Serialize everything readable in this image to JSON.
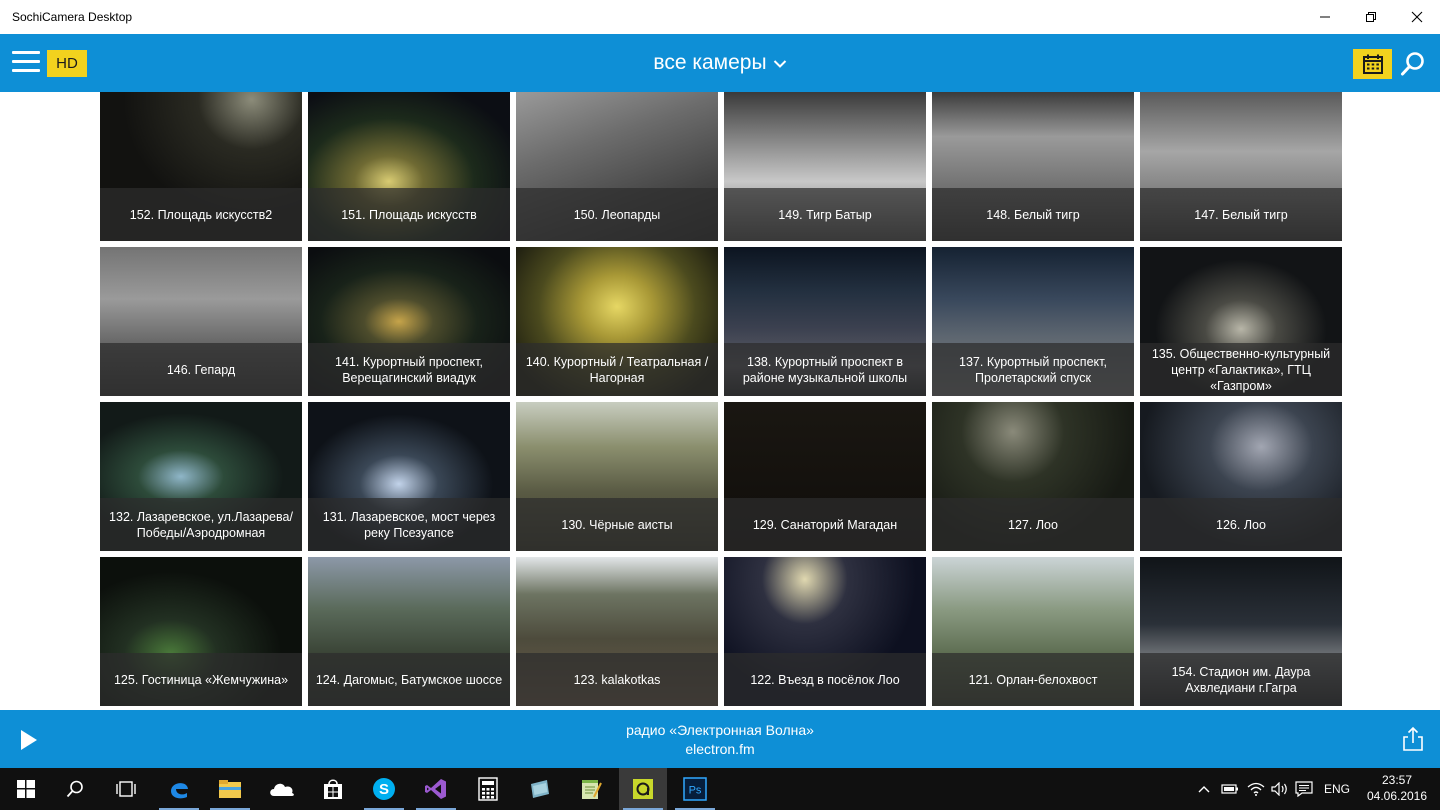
{
  "window": {
    "title": "SochiCamera Desktop"
  },
  "header": {
    "hd_label": "HD",
    "view_title": "все камеры"
  },
  "cameras": [
    {
      "label": "152. Площадь искусств2"
    },
    {
      "label": "151. Площадь искусств"
    },
    {
      "label": "150. Леопарды"
    },
    {
      "label": "149. Тигр Батыр"
    },
    {
      "label": "148. Белый тигр"
    },
    {
      "label": "147. Белый тигр"
    },
    {
      "label": "146. Гепард"
    },
    {
      "label": "141. Курортный проспект, Верещагинский виадук"
    },
    {
      "label": "140. Курортный / Театральная / Нагорная"
    },
    {
      "label": "138. Курортный проспект в районе музыкальной школы"
    },
    {
      "label": "137. Курортный проспект, Пролетарский спуск"
    },
    {
      "label": "135. Общественно-культурный центр «Галактика», ГТЦ «Газпром»"
    },
    {
      "label": "132. Лазаревское, ул.Лазарева/ Победы/Аэродромная"
    },
    {
      "label": "131. Лазаревское, мост через реку Псезуапсе"
    },
    {
      "label": "130. Чёрные аисты"
    },
    {
      "label": "129. Санаторий Магадан"
    },
    {
      "label": "127. Лоо"
    },
    {
      "label": "126. Лоо"
    },
    {
      "label": "125. Гостиница «Жемчужина»"
    },
    {
      "label": "124. Дагомыс, Батумское шоссе"
    },
    {
      "label": "123. kalakotkas"
    },
    {
      "label": "122. Въезд в посёлок Лоо"
    },
    {
      "label": "121. Орлан-белохвост"
    },
    {
      "label": "154. Стадион им. Даура Ахвледиани г.Гагра"
    }
  ],
  "player": {
    "station": "радио «Электронная Волна»",
    "site": "electron.fm"
  },
  "taskbar": {
    "language": "ENG",
    "time": "23:57",
    "date": "04.06.2016",
    "apps": [
      "start-icon",
      "search-icon",
      "task-view-icon",
      "edge-icon",
      "file-explorer-icon",
      "onedrive-icon",
      "store-icon",
      "skype-icon",
      "visual-studio-icon",
      "calculator-icon",
      "app-icon",
      "notepad-icon",
      "sochicamera-icon",
      "photoshop-icon"
    ]
  },
  "colors": {
    "accent": "#0e8fd6",
    "highlight": "#f2d21e"
  }
}
